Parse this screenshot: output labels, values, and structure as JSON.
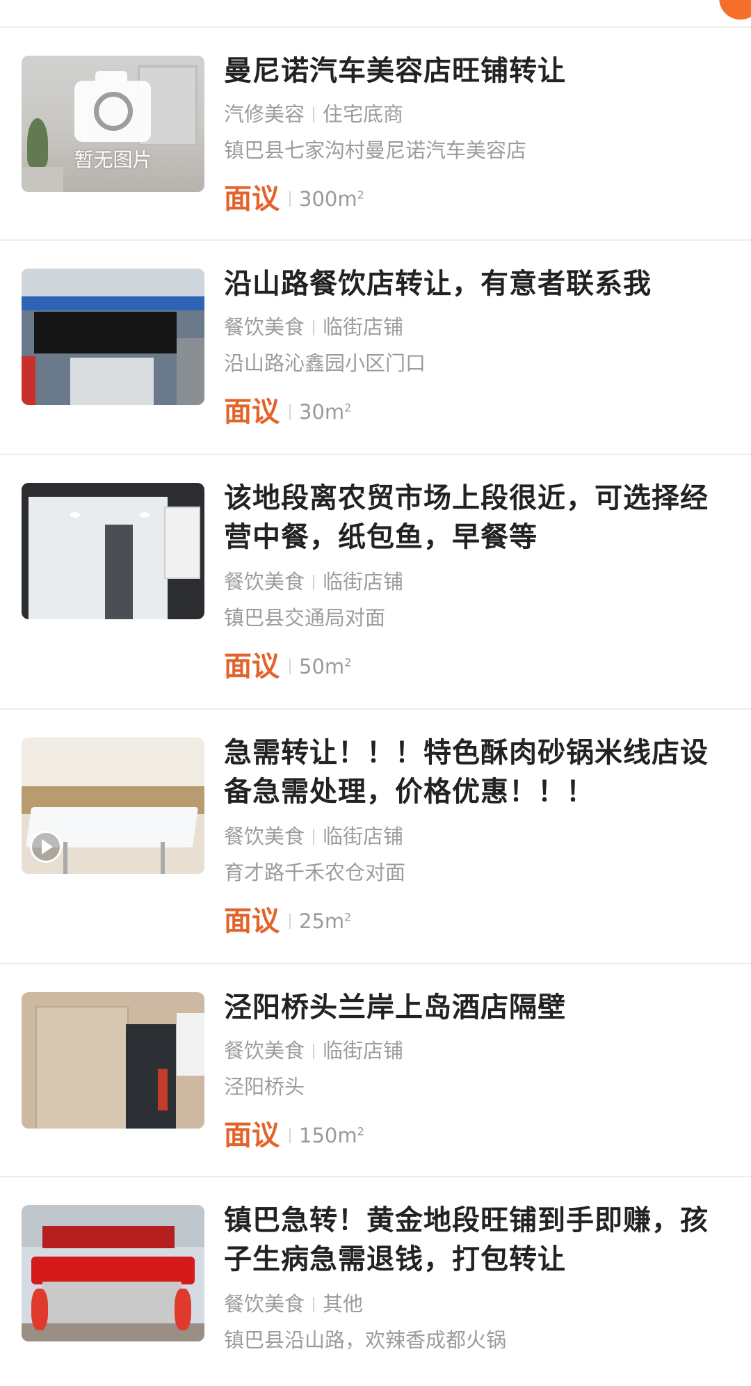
{
  "listings": [
    {
      "title": "曼尼诺汽车美容店旺铺转让",
      "category": "汽修美容",
      "type": "住宅底商",
      "address": "镇巴县七家沟村曼尼诺汽车美容店",
      "price": "面议",
      "area": "300m",
      "thumbnail_text": "暂无图片",
      "thumbnail": "no-image-placeholder"
    },
    {
      "title": "沿山路餐饮店转让，有意者联系我",
      "category": "餐饮美食",
      "type": "临街店铺",
      "address": "沿山路沁鑫园小区门口",
      "price": "面议",
      "area": "30m",
      "thumbnail": "shop-front-photo"
    },
    {
      "title": "该地段离农贸市场上段很近，可选择经营中餐，纸包鱼，早餐等",
      "category": "餐饮美食",
      "type": "临街店铺",
      "address": "镇巴县交通局对面",
      "price": "面议",
      "area": "50m",
      "thumbnail": "shop-window-photo"
    },
    {
      "title": "急需转让！！！特色酥肉砂锅米线店设备急需处理，价格优惠！！！",
      "category": "餐饮美食",
      "type": "临街店铺",
      "address": "育才路千禾农仓对面",
      "price": "面议",
      "area": "25m",
      "thumbnail": "video-thumbnail"
    },
    {
      "title": "泾阳桥头兰岸上岛酒店隔壁",
      "category": "餐饮美食",
      "type": "临街店铺",
      "address": "泾阳桥头",
      "price": "面议",
      "area": "150m",
      "thumbnail": "interior-photo"
    },
    {
      "title": "镇巴急转！黄金地段旺铺到手即赚，孩子生病急需退钱，打包转让",
      "category": "餐饮美食",
      "type": "其他",
      "address": "镇巴县沿山路，欢辣香成都火锅",
      "price": "面议",
      "area": "",
      "thumbnail": "hotpot-storefront-photo"
    }
  ],
  "area_unit_superscript": "2",
  "colors": {
    "price": "#e4632b",
    "title": "#222222",
    "meta": "#9c9c9c",
    "accent": "#f36f2a"
  }
}
